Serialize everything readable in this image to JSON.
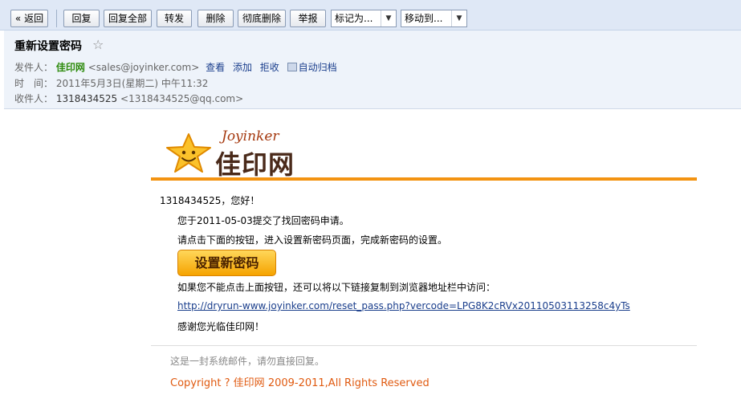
{
  "toolbar": {
    "back": "« 返回",
    "reply": "回复",
    "reply_all": "回复全部",
    "forward": "转发",
    "delete": "删除",
    "delete_permanently": "彻底删除",
    "report": "举报",
    "mark_as": "标记为...",
    "move_to": "移动到..."
  },
  "email": {
    "subject": "重新设置密码",
    "from_label": "发件人：",
    "from_name": "佳印网",
    "from_addr": "<sales@joyinker.com>",
    "from_actions": [
      "查看",
      "添加",
      "拒收",
      "自动归档"
    ],
    "time_label": "时　间：",
    "time_value": "2011年5月3日(星期二) 中午11:32",
    "to_label": "收件人：",
    "to_name": "1318434525",
    "to_addr": "<1318434525@qq.com>"
  },
  "body": {
    "logo_en": "Joyinker",
    "logo_cn": "佳印网",
    "greeting": "1318434525，您好！",
    "line1": "您于2011-05-03提交了找回密码申请。",
    "line2": "请点击下面的按钮，进入设置新密码页面，完成新密码的设置。",
    "button_label": "设置新密码",
    "line3": "如果您不能点击上面按钮，还可以将以下链接复制到浏览器地址栏中访问：",
    "reset_url": "http://dryrun-www.joyinker.com/reset_pass.php?vercode=LPG8K2cRVx20110503113258c4yTs",
    "thanks": "感谢您光临佳印网！",
    "footer_note": "这是一封系统邮件，请勿直接回复。",
    "copyright": "Copyright ? 佳印网 2009-2011,All Rights Reserved"
  },
  "colors": {
    "toolbar_bg": "#dfe8f6",
    "header_bg": "#eef3fa",
    "accent_orange": "#f39311",
    "sender_green": "#2e8b0e",
    "link_blue": "#1a3e8c",
    "copyright_orange": "#e05a10"
  }
}
